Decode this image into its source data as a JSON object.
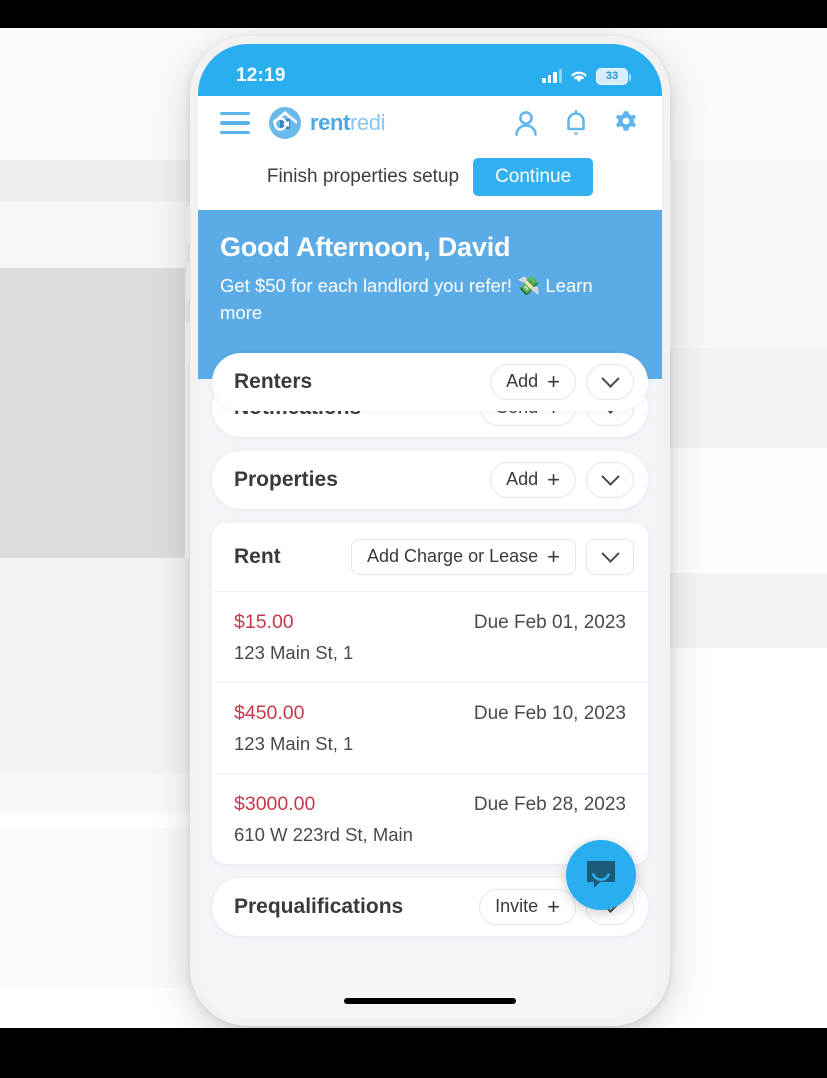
{
  "status_bar": {
    "time": "12:19",
    "battery_level": "33",
    "signal_icon": "cellular-signal-icon",
    "wifi_icon": "wifi-icon",
    "battery_icon": "battery-icon"
  },
  "header": {
    "menu_icon": "hamburger-menu-icon",
    "logo_mark_icon": "rentredi-logo-mark-icon",
    "logo_text_bold": "rent",
    "logo_text_light": "redi",
    "profile_icon": "person-icon",
    "notifications_icon": "bell-icon",
    "settings_icon": "gear-icon"
  },
  "setup_banner": {
    "message": "Finish properties setup",
    "button_label": "Continue"
  },
  "hero": {
    "greeting": "Good Afternoon, David",
    "referral_text": "Get $50 for each landlord you refer! 💸 Learn more",
    "background_color": "#5aabe6"
  },
  "sections": [
    {
      "title": "Renters",
      "action_label": "Add",
      "action_plus": "+",
      "expand_icon": "chevron-down-icon"
    },
    {
      "title": "Notifications",
      "action_label": "Send",
      "action_plus": "+",
      "expand_icon": "chevron-down-icon"
    },
    {
      "title": "Properties",
      "action_label": "Add",
      "action_plus": "+",
      "expand_icon": "chevron-down-icon"
    },
    {
      "title": "Prequalifications",
      "action_label": "Invite",
      "action_plus": "+",
      "expand_icon": "chevron-down-icon"
    }
  ],
  "rent": {
    "title": "Rent",
    "action_label": "Add Charge or Lease",
    "action_plus": "+",
    "expand_icon": "chevron-down-icon",
    "amount_color": "#c9384a",
    "rows": [
      {
        "amount": "$15.00",
        "due": "Due Feb 01, 2023",
        "address": "123 Main St, 1"
      },
      {
        "amount": "$450.00",
        "due": "Due Feb 10, 2023",
        "address": "123 Main St, 1"
      },
      {
        "amount": "$3000.00",
        "due": "Due Feb 28, 2023",
        "address": "610 W 223rd St, Main"
      }
    ]
  },
  "intercom": {
    "icon": "chat-bubble-icon",
    "color": "#29aef0"
  },
  "theme": {
    "status_bar_blue": "#29aef0",
    "accent_blue": "#32b0ef",
    "hero_blue": "#5aabe6",
    "logo_blue": "#4aa9e4"
  }
}
